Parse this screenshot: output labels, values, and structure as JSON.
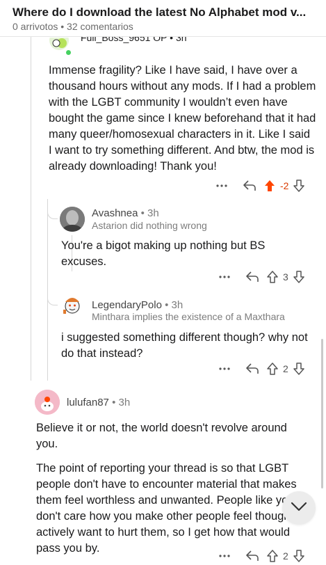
{
  "header": {
    "title": "Where do I download the latest No Alphabet mod v...",
    "meta": "0 arrivotos • 32 comentarios"
  },
  "comments": [
    {
      "author_partial": "Full_Boss_9651 OP • 3h",
      "body": "Immense fragility? Like I have said, I have over a thousand hours without any mods. If I had a problem with the LGBT community I wouldn’t even have bought the game since I knew beforehand that it had many queer/homosexual characters in it. Like I said I want to try something different. And btw, the mod is already downloading! Thank you!",
      "vote_count": "-2"
    },
    {
      "author": "Avashnea",
      "time": "• 3h",
      "flair": "Astarion did nothing wrong",
      "body": "You're a bigot making up nothing but  BS excuses.",
      "vote_count": "3"
    },
    {
      "author": "LegendaryPolo",
      "time": "• 3h",
      "flair": "Minthara implies the existence of a Maxthara",
      "body": "i suggested something different though? why not do that instead?",
      "vote_count": "2"
    },
    {
      "author": "lulufan87",
      "time": "• 3h",
      "body_p1": "Believe it or not, the world doesn't revolve around you.",
      "body_p2": "The point of reporting your thread is so that LGBT people don't have to encounter material that makes them feel worthless and unwanted. People like you don't care how you make other people feel though, or actively want to hurt them, so I get how that would pass you by.",
      "vote_count": "2"
    }
  ],
  "icons": {
    "more": "more-icon",
    "reply": "reply-icon",
    "upvote": "upvote-icon",
    "downvote": "downvote-icon",
    "collapse": "chevron-down-icon"
  },
  "colors": {
    "upvoted": "#ff4500",
    "negative_count": "#d93a00",
    "thread_line": "#d6d6d6"
  }
}
